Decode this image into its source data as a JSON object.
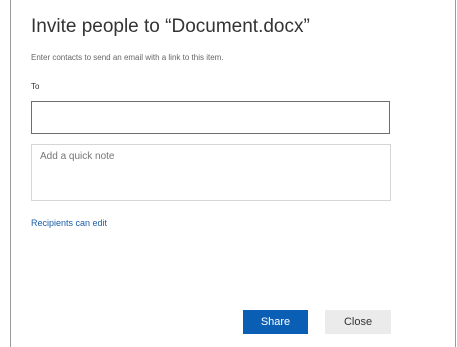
{
  "dialog": {
    "title": "Invite people to “Document.docx”",
    "subtitle": "Enter contacts to send an email with a link to this item.",
    "to_label": "To",
    "to_value": "",
    "note_placeholder": "Add a quick note",
    "note_value": "",
    "recipients_link": "Recipients can edit",
    "share_label": "Share",
    "close_label": "Close"
  },
  "colors": {
    "primary_button": "#0a5fb4",
    "link": "#1a5ea8",
    "secondary_button": "#ebebeb"
  }
}
